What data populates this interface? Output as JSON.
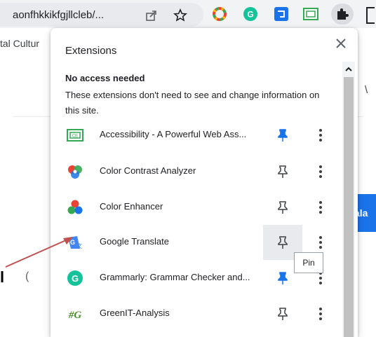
{
  "browser": {
    "url": "aonfhkkikfgjllcleb/...",
    "bookmark_text": "tal Cultur"
  },
  "page": {
    "right_fragment": "\\",
    "button_fragment": "ala",
    "left_char": "l",
    "left_char2": "("
  },
  "popup": {
    "title": "Extensions",
    "section_title": "No access needed",
    "section_desc": "These extensions don't need to see and change information on this site.",
    "extensions": [
      {
        "name": "Accessibility - A Powerful Web Ass...",
        "pinned": true
      },
      {
        "name": "Color Contrast Analyzer",
        "pinned": false
      },
      {
        "name": "Color Enhancer",
        "pinned": false
      },
      {
        "name": "Google Translate",
        "pinned": false,
        "hovered": true
      },
      {
        "name": "Grammarly: Grammar Checker and...",
        "pinned": true
      },
      {
        "name": "GreenIT-Analysis",
        "pinned": false
      }
    ],
    "tooltip": "Pin"
  },
  "colors": {
    "pin_active": "#1a73e8",
    "annotation_arrow": "#c0504d"
  }
}
